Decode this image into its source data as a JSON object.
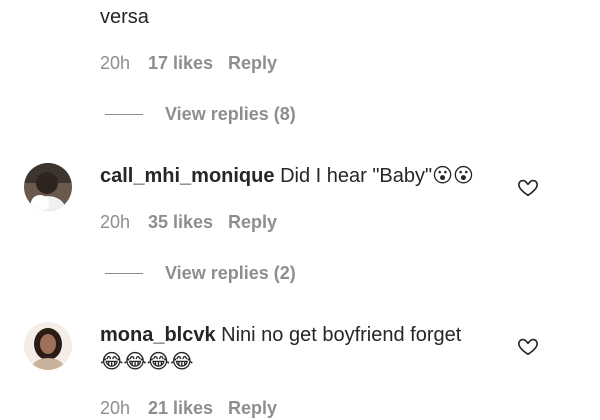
{
  "comments": [
    {
      "text_tail": "versa",
      "time": "20h",
      "likes": "17 likes",
      "reply": "Reply",
      "view_replies": "View replies (8)"
    },
    {
      "username": "call_mhi_monique",
      "text": "Did I hear \"Baby\"",
      "emojis": "😮😮",
      "time": "20h",
      "likes": "35 likes",
      "reply": "Reply",
      "view_replies": "View replies (2)"
    },
    {
      "username": "mona_blcvk",
      "text": "Nini no get boyfriend forget",
      "emojis": "😂😂😂😂",
      "time": "20h",
      "likes": "21 likes",
      "reply": "Reply"
    }
  ],
  "icons": {
    "like": "heart-outline-icon"
  },
  "colors": {
    "text": "#262626",
    "muted": "#8e8e8e"
  }
}
